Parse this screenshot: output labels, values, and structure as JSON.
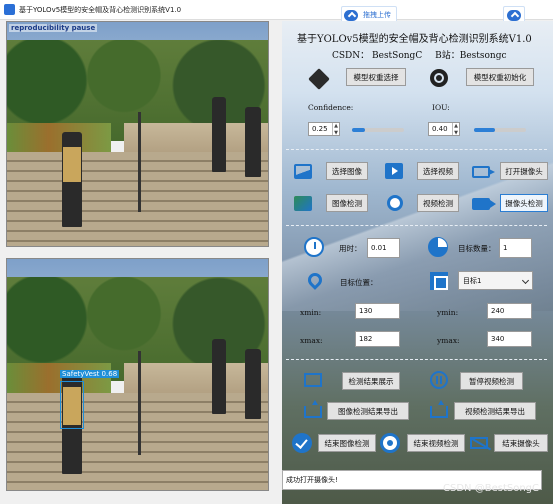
{
  "window": {
    "title": "基于YOLOv5模型的安全帽及背心检测识别系统V1.0"
  },
  "upload": {
    "label": "拖拽上传"
  },
  "watermark": "reproducibility pause",
  "detection": {
    "label": "SafetyVest 0.68"
  },
  "header": {
    "title": "基于YOLOv5模型的安全帽及背心检测识别系统V1.0",
    "csdn": "CSDN：  BestSongC",
    "bilibili": "B站：Bestsongc"
  },
  "model": {
    "select_weights": "模型权重选择",
    "init_weights": "模型权重初始化"
  },
  "params": {
    "confidence_label": "Confidence:",
    "confidence_value": "0.25",
    "iou_label": "IOU:",
    "iou_value": "0.40",
    "confidence_slider": 0.25,
    "iou_slider": 0.4
  },
  "inputs": {
    "select_image": "选择图像",
    "select_video": "选择视频",
    "open_camera": "打开摄像头",
    "image_detect": "图像检测",
    "video_detect": "视频检测",
    "camera_detect": "摄像头检测"
  },
  "results": {
    "time_label": "用时：",
    "time_value": "0.01",
    "count_label": "目标数量：",
    "count_value": "1",
    "position_label": "目标位置：",
    "target_select": "目标1",
    "xmin_label": "xmin:",
    "xmin_value": "130",
    "ymin_label": "ymin:",
    "ymin_value": "240",
    "xmax_label": "xmax:",
    "xmax_value": "182",
    "ymax_label": "ymax:",
    "ymax_value": "340"
  },
  "actions": {
    "show_results": "检测结果展示",
    "pause_video": "暂停视频检测",
    "export_image": "图像检测结果导出",
    "export_video": "视频检测结果导出",
    "end_image": "结束图像检测",
    "end_video": "结束视频检测",
    "end_camera": "结束摄像头"
  },
  "status": "成功打开摄像头!",
  "footer_watermark": "CSDN @BestSongC",
  "colors": {
    "accent": "#1f74c9",
    "detection": "#1f8fd8"
  }
}
